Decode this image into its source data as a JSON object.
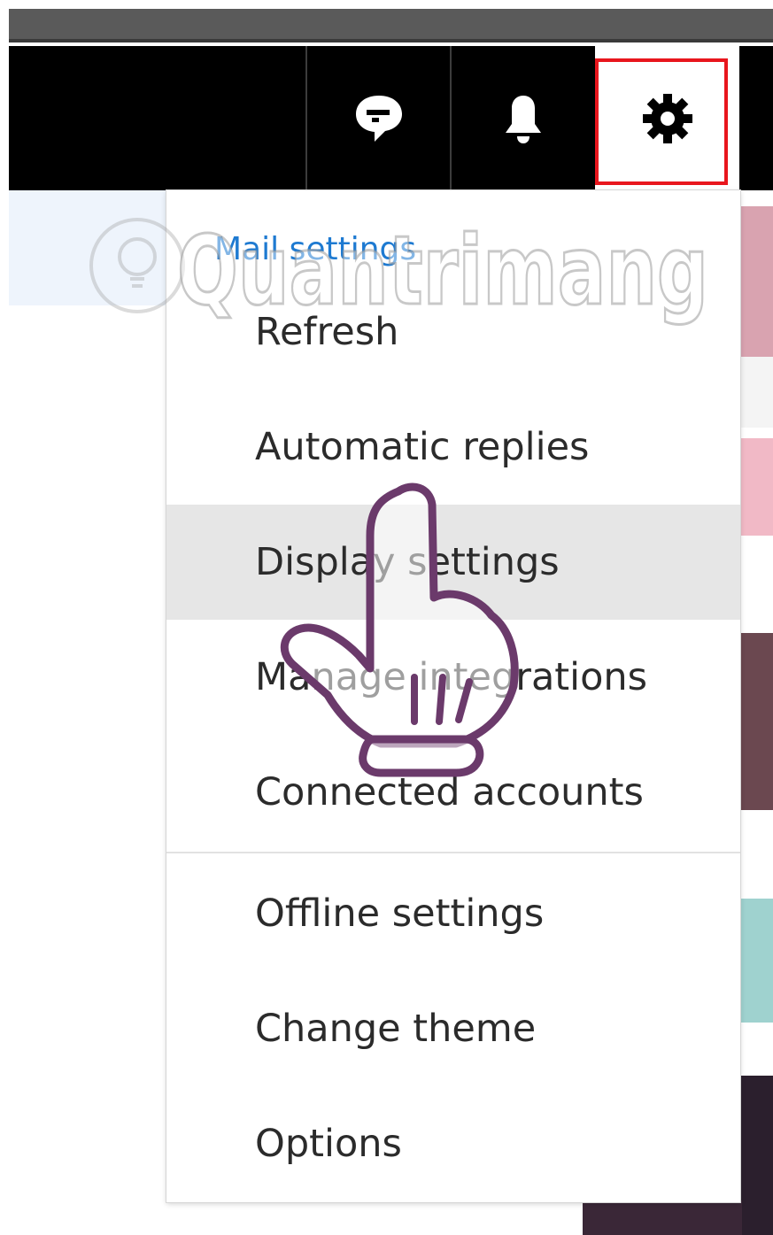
{
  "header": {
    "icons": [
      "chat-icon",
      "bell-icon",
      "gear-icon"
    ]
  },
  "menu": {
    "heading": "Mail settings",
    "items": [
      {
        "label": "Refresh"
      },
      {
        "label": "Automatic replies"
      },
      {
        "label": "Display settings"
      },
      {
        "label": "Manage integrations"
      },
      {
        "label": "Connected accounts"
      },
      {
        "label": "Offline settings"
      },
      {
        "label": "Change theme"
      },
      {
        "label": "Options"
      }
    ],
    "hovered_index": 2
  },
  "watermark": {
    "text": "Quantrimang"
  },
  "colors": {
    "accent": "#1e7ad1",
    "highlight_border": "#e8161d",
    "hover_bg": "#e6e6e6",
    "header_bg": "#000000"
  }
}
